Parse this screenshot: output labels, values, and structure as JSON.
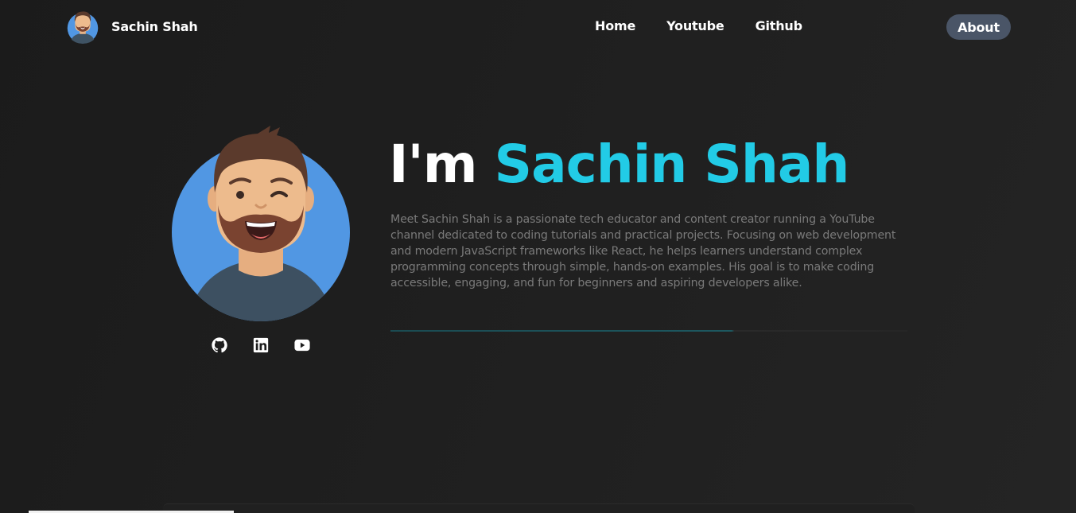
{
  "brand": {
    "name": "Sachin Shah",
    "avatar_icon": "avatar-icon"
  },
  "nav": {
    "links": [
      {
        "label": "Home"
      },
      {
        "label": "Youtube"
      },
      {
        "label": "Github"
      }
    ],
    "about_label": "About"
  },
  "hero": {
    "headline_prefix": "I'm",
    "headline_name": "Sachin Shah",
    "bio": "Meet Sachin Shah is a passionate tech educator and content creator running a YouTube channel dedicated to coding tutorials and practical projects. Focusing on web development and modern JavaScript frameworks like React, he helps learners understand complex programming concepts through simple, hands-on examples. His goal is to make coding accessible, engaging, and fun for beginners and aspiring developers alike.",
    "socials": [
      "github-icon",
      "linkedin-icon",
      "youtube-icon"
    ]
  },
  "colors": {
    "accent": "#22cbe6",
    "background": "#1d1d1d",
    "about_button": "#4a5567",
    "avatar_circle": "#5197e3"
  }
}
